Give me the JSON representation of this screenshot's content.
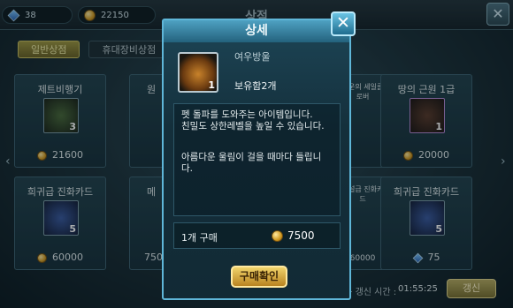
{
  "topbar": {
    "gems": "38",
    "gold": "22150",
    "title": "상점",
    "menu_icon": "close-x-icon"
  },
  "tabs": [
    {
      "label": "일반상점",
      "active": true
    },
    {
      "label": "휴대장비상점",
      "active": false
    }
  ],
  "cards": [
    {
      "name": "제트비행기",
      "count": "3",
      "price": "21600",
      "currency": "coin"
    },
    {
      "name": "원",
      "count": "",
      "price": "",
      "currency": "coin"
    },
    {
      "name": "행운의 세일클로버",
      "count": "",
      "price": "",
      "currency": "coin"
    },
    {
      "name": "땅의 근원 1급",
      "count": "1",
      "price": "20000",
      "currency": "coin"
    },
    {
      "name": "희귀급 진화카드",
      "count": "5",
      "price": "60000",
      "currency": "coin"
    },
    {
      "name": "메",
      "count": "",
      "price": "7500",
      "currency": "coin"
    },
    {
      "name": "전설급 진화카드",
      "count": "",
      "price": "60000",
      "currency": "coin"
    },
    {
      "name": "희귀급 진화카드",
      "count": "5",
      "price": "75",
      "currency": "gem"
    }
  ],
  "refresh": {
    "label": "다음 갱신 시간 :",
    "time": "01:55:25",
    "button": "갱신"
  },
  "modal": {
    "title": "상세",
    "item_name": "여우방울",
    "item_count": "1",
    "owned": "보유함2개",
    "description": "펫 돌파를 도와주는 아이템입니다.\n친밀도 상한레벨을 높일 수 있습니다.",
    "description2": "아름다운 울림이 걸을 때마다 들립니다.",
    "quantity": "1개 구매",
    "price": "7500",
    "confirm": "구매확인"
  }
}
